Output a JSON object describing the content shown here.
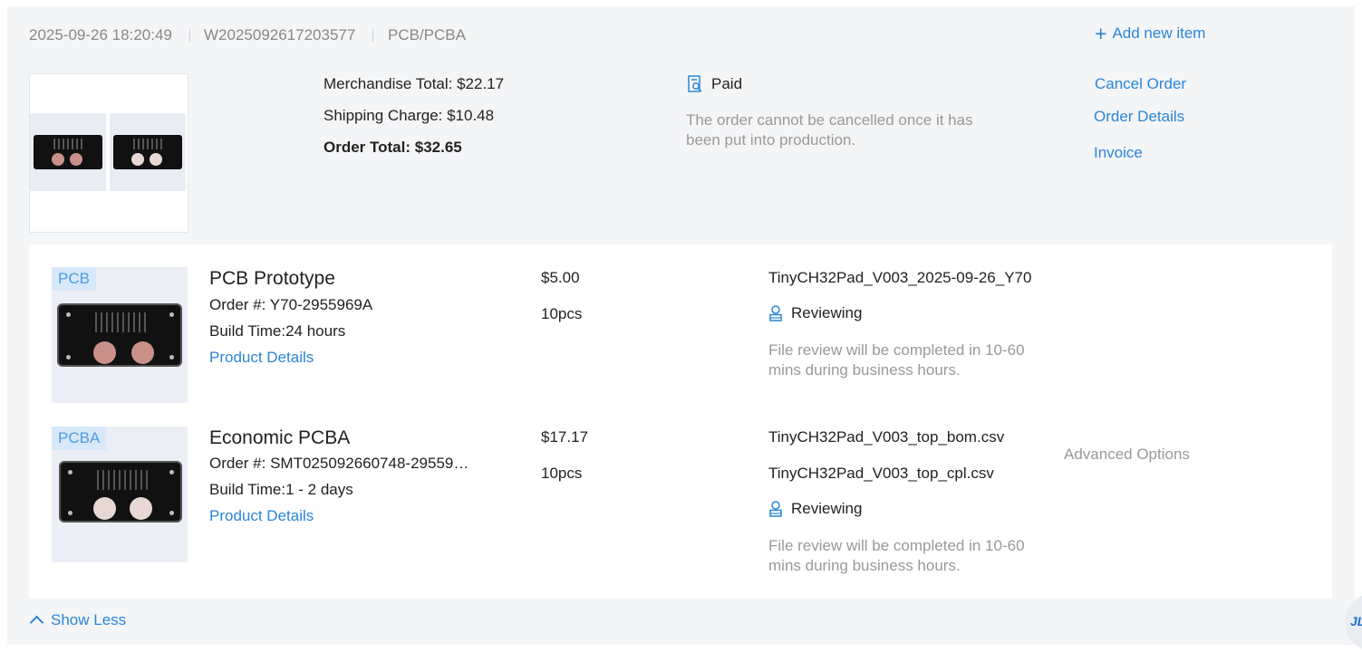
{
  "order": {
    "datetime": "2025-09-26 18:20:49",
    "order_no": "W2025092617203577",
    "category": "PCB/PCBA",
    "add_item_label": "Add new item"
  },
  "summary": {
    "merchandise_total": "Merchandise Total: $22.17",
    "shipping_charge": "Shipping Charge: $10.48",
    "order_total": "Order Total: $32.65"
  },
  "status": {
    "label": "Paid",
    "note": "The order cannot be cancelled once it has been put into production."
  },
  "actions": {
    "cancel": "Cancel Order",
    "details": "Order Details",
    "invoice": "Invoice"
  },
  "items": [
    {
      "tag": "PCB",
      "title": "PCB Prototype",
      "order_no": "Order #: Y70-2955969A",
      "build_time": "Build Time:24 hours",
      "details_link": "Product Details",
      "price": "$5.00",
      "qty": "10pcs",
      "files": [
        "TinyCH32Pad_V003_2025-09-26_Y70"
      ],
      "review_status": "Reviewing",
      "review_note": "File review will be completed in 10-60 mins during business hours."
    },
    {
      "tag": "PCBA",
      "title": "Economic PCBA",
      "order_no": "Order #: SMT025092660748-29559…",
      "build_time": "Build Time:1 - 2 days",
      "details_link": "Product Details",
      "price": "$17.17",
      "qty": "10pcs",
      "files": [
        "TinyCH32Pad_V003_top_bom.csv",
        "TinyCH32Pad_V003_top_cpl.csv"
      ],
      "review_status": "Reviewing",
      "review_note": "File review will be completed in 10-60 mins during business hours.",
      "advanced_options": "Advanced Options"
    }
  ],
  "footer": {
    "show_less": "Show Less",
    "help_bubble": "JL"
  },
  "colors": {
    "accent": "#2a86d6",
    "card_bg": "#f4f5f7",
    "muted_text": "#999999",
    "tag_bg": "#d7e8fa",
    "pad_copper": "#c9908a",
    "pad_white": "#e8d8d4"
  }
}
